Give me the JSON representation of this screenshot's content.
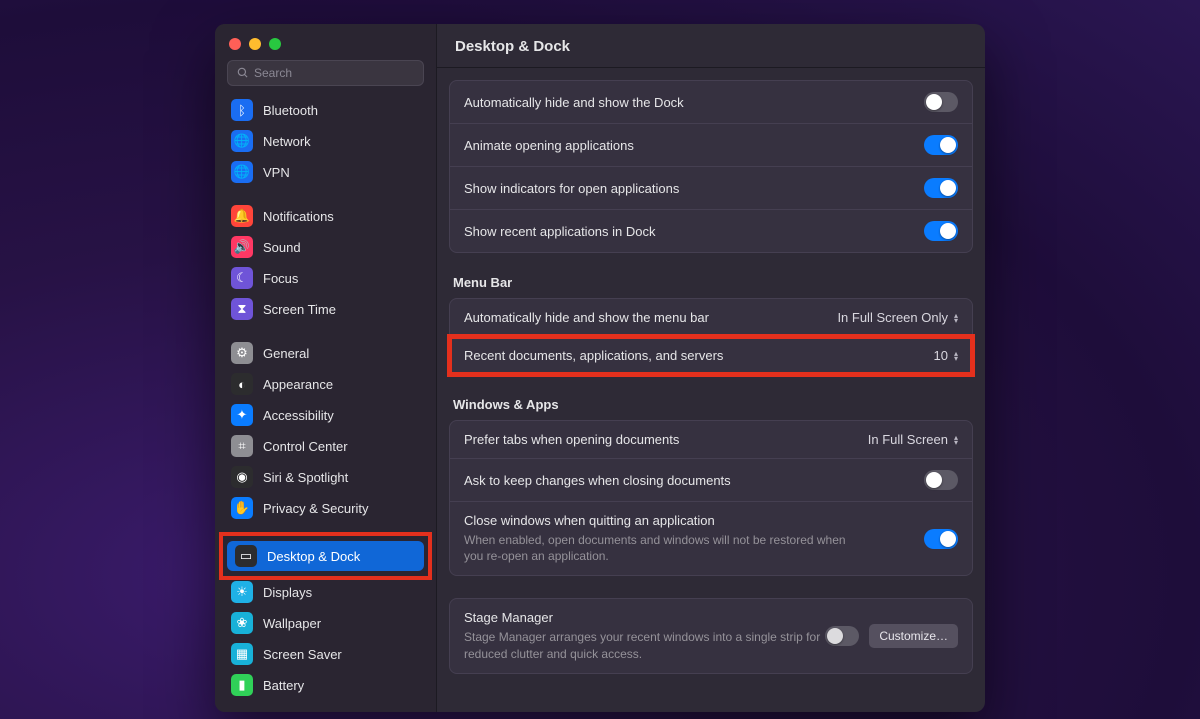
{
  "search": {
    "placeholder": "Search"
  },
  "header": {
    "title": "Desktop & Dock"
  },
  "sidebar": {
    "items": [
      {
        "label": "Bluetooth",
        "icon_bg": "#1a6df2",
        "glyph": "ᛒ",
        "name": "bluetooth"
      },
      {
        "label": "Network",
        "icon_bg": "#1a6df2",
        "glyph": "🌐",
        "name": "network"
      },
      {
        "label": "VPN",
        "icon_bg": "#1a6df2",
        "glyph": "🌐",
        "name": "vpn"
      }
    ],
    "items2": [
      {
        "label": "Notifications",
        "icon_bg": "#ff453a",
        "glyph": "🔔",
        "name": "notifications"
      },
      {
        "label": "Sound",
        "icon_bg": "#ff3864",
        "glyph": "🔊",
        "name": "sound"
      },
      {
        "label": "Focus",
        "icon_bg": "#6f54d8",
        "glyph": "☾",
        "name": "focus"
      },
      {
        "label": "Screen Time",
        "icon_bg": "#6f54d8",
        "glyph": "⧗",
        "name": "screen-time"
      }
    ],
    "items3": [
      {
        "label": "General",
        "icon_bg": "#8e8e93",
        "glyph": "⚙︎",
        "name": "general"
      },
      {
        "label": "Appearance",
        "icon_bg": "#2c2c2e",
        "glyph": "◐",
        "name": "appearance"
      },
      {
        "label": "Accessibility",
        "icon_bg": "#0a7cff",
        "glyph": "✦",
        "name": "accessibility"
      },
      {
        "label": "Control Center",
        "icon_bg": "#8e8e93",
        "glyph": "⌗",
        "name": "control-center"
      },
      {
        "label": "Siri & Spotlight",
        "icon_bg": "#2c2c2e",
        "glyph": "◉",
        "name": "siri-spotlight"
      },
      {
        "label": "Privacy & Security",
        "icon_bg": "#0a7cff",
        "glyph": "✋",
        "name": "privacy-security"
      }
    ],
    "items4": [
      {
        "label": "Desktop & Dock",
        "icon_bg": "#2c2c2e",
        "glyph": "▭",
        "name": "desktop-dock",
        "selected": true,
        "highlight": true
      },
      {
        "label": "Displays",
        "icon_bg": "#1fb1e6",
        "glyph": "☀︎",
        "name": "displays"
      },
      {
        "label": "Wallpaper",
        "icon_bg": "#18b1d8",
        "glyph": "❀",
        "name": "wallpaper"
      },
      {
        "label": "Screen Saver",
        "icon_bg": "#18b1d8",
        "glyph": "▦",
        "name": "screen-saver"
      },
      {
        "label": "Battery",
        "icon_bg": "#30d158",
        "glyph": "▮",
        "name": "battery"
      }
    ]
  },
  "dock_group": [
    {
      "label": "Automatically hide and show the Dock",
      "on": false
    },
    {
      "label": "Animate opening applications",
      "on": true
    },
    {
      "label": "Show indicators for open applications",
      "on": true
    },
    {
      "label": "Show recent applications in Dock",
      "on": true
    }
  ],
  "menu_bar": {
    "title": "Menu Bar",
    "rows": [
      {
        "label": "Automatically hide and show the menu bar",
        "value": "In Full Screen Only"
      },
      {
        "label": "Recent documents, applications, and servers",
        "value": "10",
        "highlight": true
      }
    ]
  },
  "windows_apps": {
    "title": "Windows & Apps",
    "rows": [
      {
        "label": "Prefer tabs when opening documents",
        "type": "select",
        "value": "In Full Screen"
      },
      {
        "label": "Ask to keep changes when closing documents",
        "type": "toggle",
        "on": false
      },
      {
        "label": "Close windows when quitting an application",
        "type": "toggle",
        "on": true,
        "desc": "When enabled, open documents and windows will not be restored when you re-open an application."
      }
    ]
  },
  "stage_manager": {
    "label": "Stage Manager",
    "desc": "Stage Manager arranges your recent windows into a single strip for reduced clutter and quick access.",
    "on": false,
    "button": "Customize…"
  }
}
